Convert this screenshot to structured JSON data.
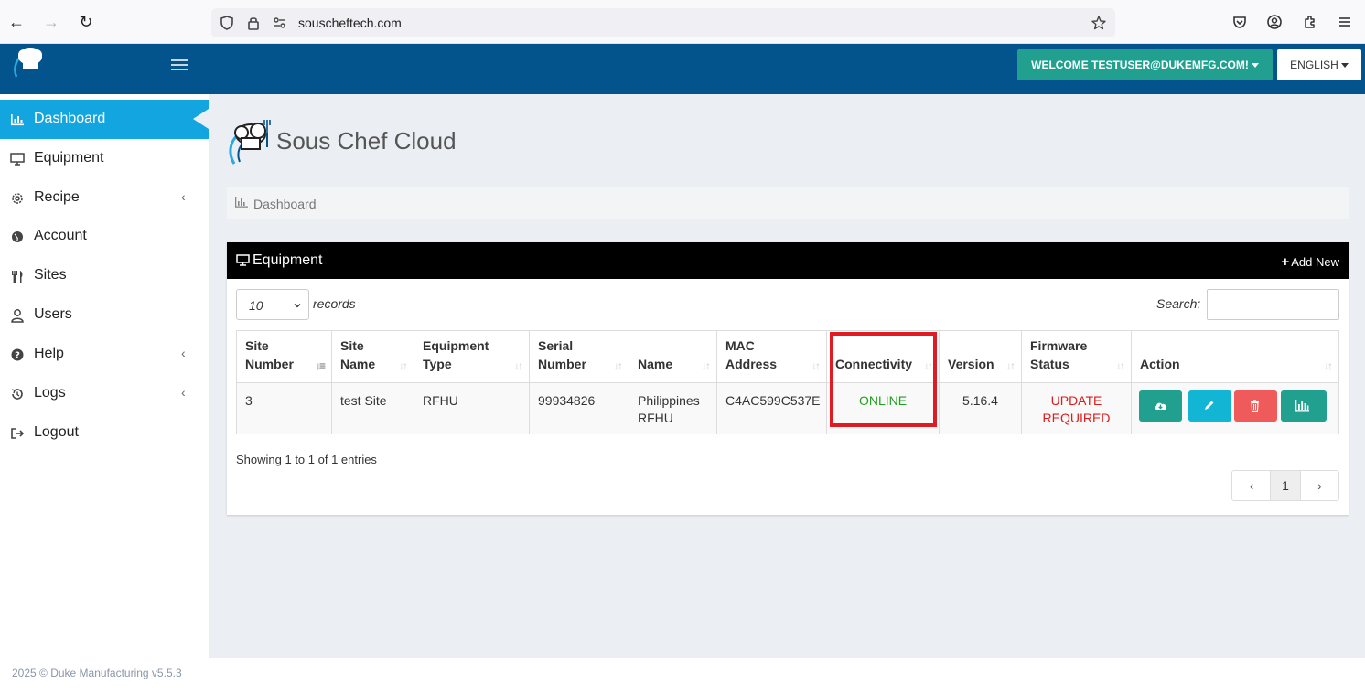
{
  "browser": {
    "url": "souscheftech.com"
  },
  "header": {
    "welcome_label": "WELCOME TESTUSER@DUKEMFG.COM!",
    "language_label": "ENGLISH"
  },
  "sidebar": {
    "items": [
      {
        "label": "Dashboard",
        "icon": "bar-chart-icon",
        "active": true
      },
      {
        "label": "Equipment",
        "icon": "monitor-icon"
      },
      {
        "label": "Recipe",
        "icon": "gear-icon",
        "chevron": "‹"
      },
      {
        "label": "Account",
        "icon": "globe-icon"
      },
      {
        "label": "Sites",
        "icon": "utensils-icon"
      },
      {
        "label": "Users",
        "icon": "user-icon"
      },
      {
        "label": "Help",
        "icon": "question-icon",
        "chevron": "‹"
      },
      {
        "label": "Logs",
        "icon": "history-icon",
        "chevron": "‹"
      },
      {
        "label": "Logout",
        "icon": "sign-out-icon"
      }
    ]
  },
  "main": {
    "brand_title": "Sous Chef Cloud",
    "breadcrumb": "Dashboard",
    "panel": {
      "title": "Equipment",
      "add_new_label": "Add New",
      "length_value": "10",
      "records_label": "records",
      "search_label": "Search:",
      "search_value": ""
    },
    "table": {
      "headers": [
        "Site Number",
        "Site Name",
        "Equipment Type",
        "Serial Number",
        "Name",
        "MAC Address",
        "Connectivity",
        "Version",
        "Firmware Status",
        "Action"
      ],
      "rows": [
        {
          "site_number": "3",
          "site_name": "test Site",
          "equipment_type": "RFHU",
          "serial_number": "99934826",
          "name": "Philippines RFHU",
          "mac_address": "C4AC599C537E",
          "connectivity": "ONLINE",
          "version": "5.16.4",
          "firmware_status": "UPDATE REQUIRED"
        }
      ],
      "action_buttons": [
        {
          "icon": "cloud-download-icon",
          "color": "#21a090"
        },
        {
          "icon": "pencil-icon",
          "color": "#13b5d4"
        },
        {
          "icon": "trash-icon",
          "color": "#ef5b5b"
        },
        {
          "icon": "bar-chart-icon",
          "color": "#21a090"
        }
      ]
    },
    "showing_text": "Showing 1 to 1 of 1 entries",
    "pagination": {
      "prev": "‹",
      "current": "1",
      "next": "›"
    }
  },
  "footer": {
    "text": "2025 © Duke Manufacturing v5.5.3"
  },
  "colors": {
    "header_bg": "#03548c",
    "active_item": "#13a5e0",
    "welcome_bg": "#21a090",
    "online": "#22a022",
    "update_required": "#e01b1b",
    "highlight_box": "#e01b24"
  }
}
